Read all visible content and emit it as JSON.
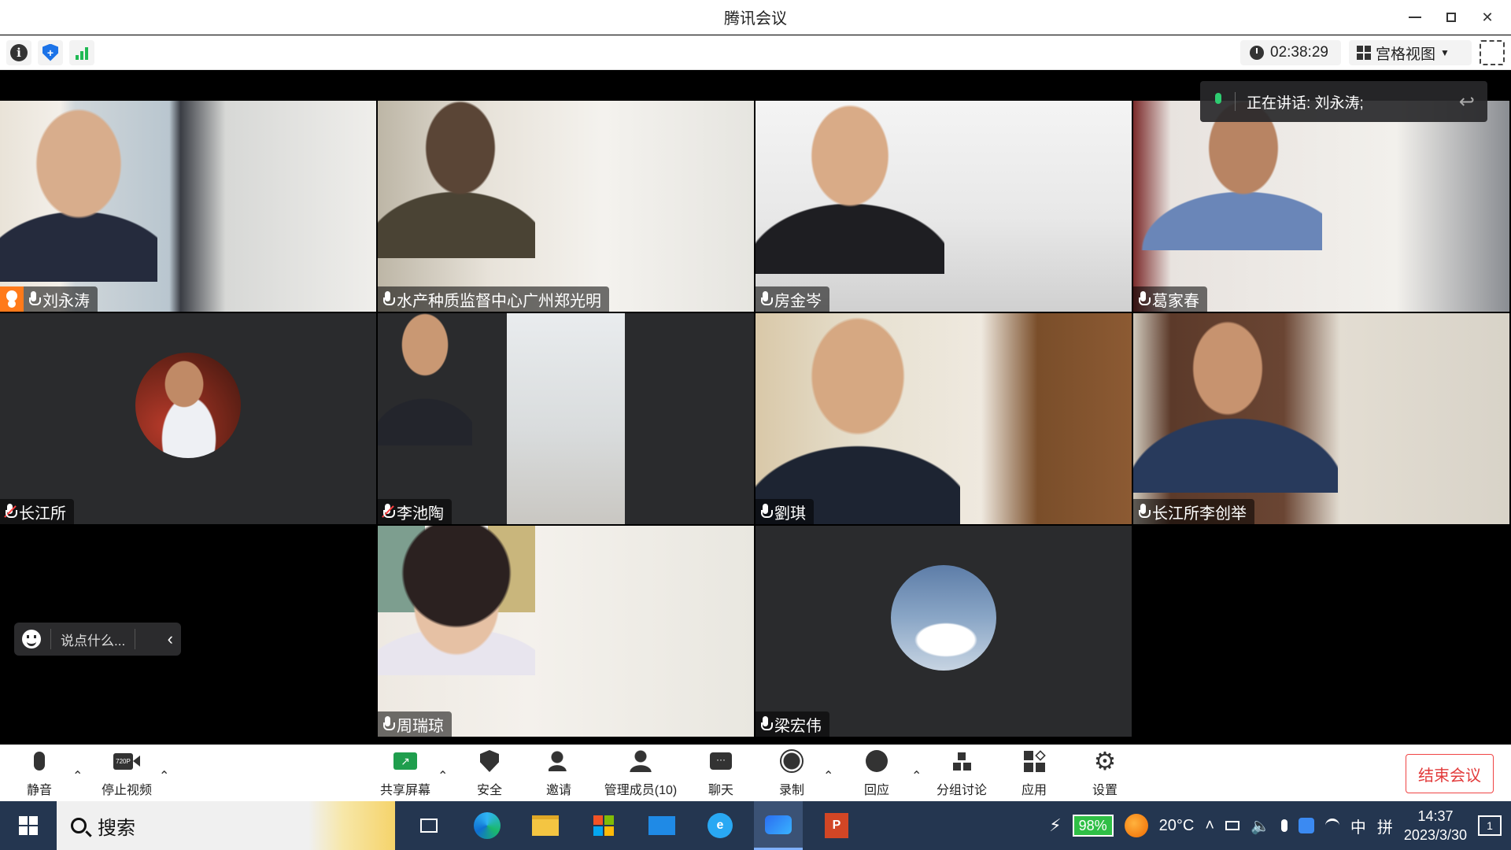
{
  "window": {
    "title": "腾讯会议"
  },
  "infobar": {
    "timer": "02:38:29",
    "view_mode": "宫格视图"
  },
  "speaking": {
    "label": "正在讲话: 刘永涛;"
  },
  "participants": [
    {
      "name": "刘永涛",
      "host": true,
      "muted": false
    },
    {
      "name": "水产种质监督中心广州郑光明",
      "muted": false
    },
    {
      "name": "房金岑",
      "muted": false
    },
    {
      "name": "葛家春",
      "muted": false
    },
    {
      "name": "长江所",
      "muted": true
    },
    {
      "name": "李池陶",
      "muted": true
    },
    {
      "name": "劉琪",
      "muted": false
    },
    {
      "name": "长江所李创举",
      "muted": false
    },
    {
      "name": "周瑞琼",
      "muted": false
    },
    {
      "name": "梁宏伟",
      "muted": false
    }
  ],
  "chat": {
    "placeholder": "说点什么..."
  },
  "toolbar": {
    "mute": "静音",
    "stop_video": "停止视频",
    "share": "共享屏幕",
    "security": "安全",
    "invite": "邀请",
    "members": "管理成员(10)",
    "chat": "聊天",
    "record": "录制",
    "reaction": "回应",
    "breakout": "分组讨论",
    "apps": "应用",
    "settings": "设置",
    "end": "结束会议",
    "video_quality": "720P"
  },
  "taskbar": {
    "search": "搜索",
    "battery": "98%",
    "temperature": "20°C",
    "ime": "中",
    "ime2": "拼",
    "time": "14:37",
    "date": "2023/3/30",
    "notifications": "1"
  }
}
